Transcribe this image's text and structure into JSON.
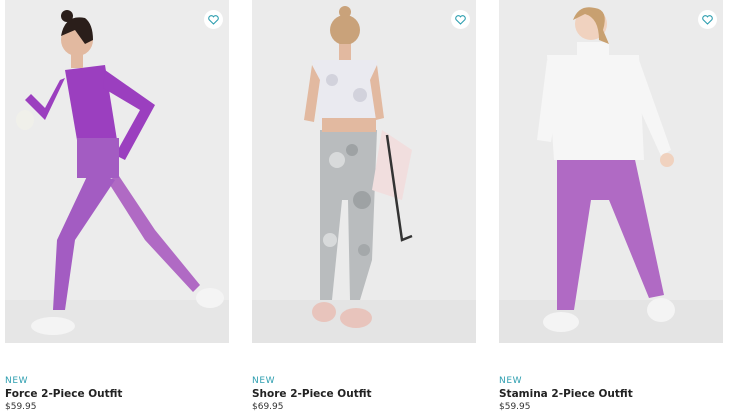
{
  "products": [
    {
      "tag": "NEW",
      "name": "Force 2-Piece Outfit",
      "price": "$59.95",
      "favorite_icon": "heart-icon"
    },
    {
      "tag": "NEW",
      "name": "Shore 2-Piece Outfit",
      "price": "$69.95",
      "favorite_icon": "heart-icon"
    },
    {
      "tag": "NEW",
      "name": "Stamina 2-Piece Outfit",
      "price": "$59.95",
      "favorite_icon": "heart-icon"
    }
  ],
  "colors": {
    "tag": "#2f9fb0",
    "heart": "#2f9fb0",
    "photo_bg": "#ededed",
    "purple": "#a35cc2",
    "legging_purple": "#b06ac4",
    "white_top": "#f4f4f4"
  }
}
